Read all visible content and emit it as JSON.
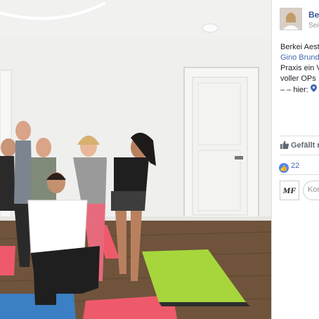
{
  "page": {
    "name": "Berl",
    "subtitle": "Seit"
  },
  "post": {
    "line1": "Berkei Aest",
    "line2_link": "Gino Brund",
    "line3": "Praxis ein V",
    "line4": "voller OPs",
    "line5_prefix": "– – hier:",
    "location_icon": "location-pin-icon"
  },
  "actions": {
    "like_label": "Gefällt m"
  },
  "reactions": {
    "count": "22"
  },
  "comment": {
    "avatar_text": "MF",
    "placeholder": "Kom"
  },
  "colors": {
    "link": "#4267b2",
    "page_name": "#365899",
    "like_blue": "#4e85f7"
  }
}
